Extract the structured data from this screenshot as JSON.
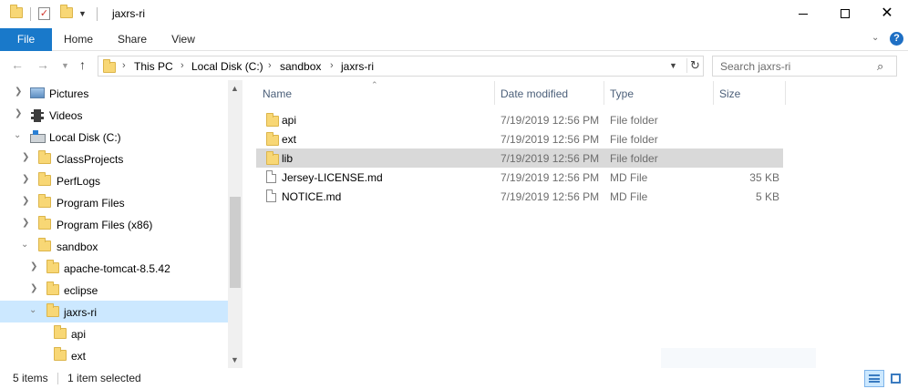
{
  "window": {
    "title": "jaxrs-ri"
  },
  "ribbon": {
    "tabs": [
      {
        "label": "File"
      },
      {
        "label": "Home"
      },
      {
        "label": "Share"
      },
      {
        "label": "View"
      }
    ],
    "help_label": "?"
  },
  "address_bar": {
    "crumbs": [
      "This PC",
      "Local Disk (C:)",
      "sandbox",
      "jaxrs-ri"
    ]
  },
  "search": {
    "placeholder": "Search jaxrs-ri"
  },
  "tree": {
    "items": [
      {
        "label": "Pictures",
        "icon": "pictures-icon",
        "chevron": "collapsed"
      },
      {
        "label": "Videos",
        "icon": "videos-icon",
        "chevron": "collapsed"
      },
      {
        "label": "Local Disk (C:)",
        "icon": "drive-icon",
        "chevron": "expanded"
      },
      {
        "label": "ClassProjects",
        "icon": "folder-icon",
        "chevron": "collapsed"
      },
      {
        "label": "PerfLogs",
        "icon": "folder-icon",
        "chevron": "collapsed"
      },
      {
        "label": "Program Files",
        "icon": "folder-icon",
        "chevron": "collapsed"
      },
      {
        "label": "Program Files (x86)",
        "icon": "folder-icon",
        "chevron": "collapsed"
      },
      {
        "label": "sandbox",
        "icon": "folder-icon",
        "chevron": "expanded"
      },
      {
        "label": "apache-tomcat-8.5.42",
        "icon": "folder-icon",
        "chevron": "collapsed"
      },
      {
        "label": "eclipse",
        "icon": "folder-icon",
        "chevron": "collapsed"
      },
      {
        "label": "jaxrs-ri",
        "icon": "folder-icon",
        "chevron": "expanded",
        "selected": true
      },
      {
        "label": "api",
        "icon": "folder-icon",
        "chevron": "none"
      },
      {
        "label": "ext",
        "icon": "folder-icon",
        "chevron": "none"
      }
    ]
  },
  "file_list": {
    "columns": [
      "Name",
      "Date modified",
      "Type",
      "Size"
    ],
    "rows": [
      {
        "name": "api",
        "date": "7/19/2019 12:56 PM",
        "type": "File folder",
        "size": "",
        "icon": "folder-icon"
      },
      {
        "name": "ext",
        "date": "7/19/2019 12:56 PM",
        "type": "File folder",
        "size": "",
        "icon": "folder-icon"
      },
      {
        "name": "lib",
        "date": "7/19/2019 12:56 PM",
        "type": "File folder",
        "size": "",
        "icon": "folder-icon",
        "highlighted": true
      },
      {
        "name": "Jersey-LICENSE.md",
        "date": "7/19/2019 12:56 PM",
        "type": "MD File",
        "size": "35 KB",
        "icon": "document-icon"
      },
      {
        "name": "NOTICE.md",
        "date": "7/19/2019 12:56 PM",
        "type": "MD File",
        "size": "5 KB",
        "icon": "document-icon"
      }
    ]
  },
  "status_bar": {
    "item_count": "5 items",
    "selection": "1 item selected"
  },
  "colors": {
    "accent": "#1979ca",
    "selection": "#cce8ff",
    "hover_row": "#d9d9d9"
  }
}
